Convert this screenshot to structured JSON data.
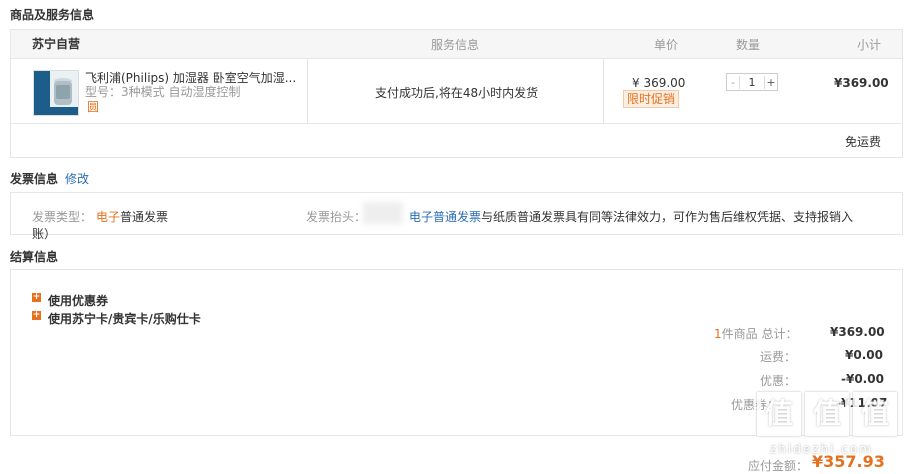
{
  "sections": {
    "goods_title": "商品及服务信息",
    "invoice_title": "发票信息",
    "invoice_edit": "修改",
    "settlement_title": "结算信息"
  },
  "table": {
    "store": "苏宁自营",
    "col_service": "服务信息",
    "col_price": "单价",
    "col_qty": "数量",
    "col_subtotal": "小计"
  },
  "item": {
    "name": "飞利浦(Philips) 加湿器 卧室空气加湿...",
    "model": "型号：3种模式 自动湿度控制",
    "extra": "圆",
    "service": "支付成功后,将在48小时内发货",
    "price": "¥ 369.00",
    "promo": "限时促销",
    "qty": "1",
    "minus": "-",
    "plus": "+",
    "subtotal": "¥369.00",
    "shipping": "免运费"
  },
  "invoice": {
    "type_label": "发票类型：",
    "type_value_colored": "电子",
    "type_value_rest": "普通发票",
    "type_wrap": "账）",
    "header_label": "发票抬头：",
    "header_note_link": "电子普通发票",
    "header_note_rest": "与纸质普通发票具有同等法律效力，可作为售后维权凭据、支持报销入"
  },
  "settlement": {
    "coupon": "使用优惠券",
    "cards": "使用苏宁卡/贵宾卡/乐购仕卡",
    "count_num": "1",
    "count_label": "件商品 总计：",
    "total": "¥369.00",
    "freight_label": "运费：",
    "freight": "¥0.00",
    "discount_label": "优惠：",
    "discount": "-¥0.00",
    "coupon_label": "优惠券：",
    "coupon_value": "-¥11.07",
    "payable_label": "应付金额：",
    "payable": "¥357.93"
  },
  "watermark": {
    "logo": "值",
    "url": "zhidezhi.com"
  },
  "colors": {
    "accent": "#e5711f",
    "link": "#2a6cb5",
    "border": "#e6e6e6"
  }
}
